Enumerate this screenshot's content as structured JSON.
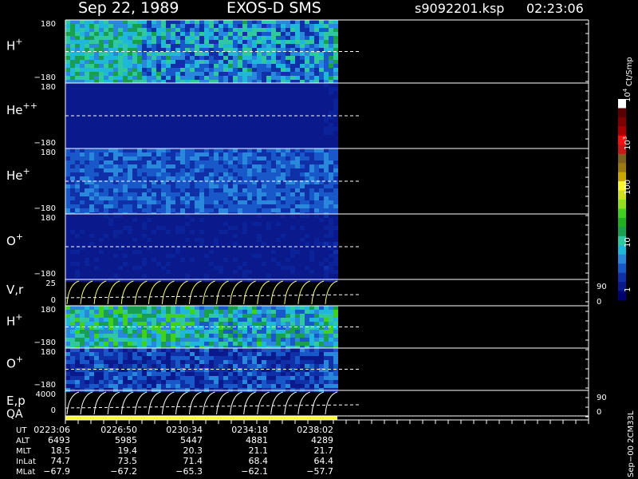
{
  "header": {
    "date": "Sep 22, 1989",
    "instrument": "EXOS-D SMS",
    "file": "s9092201.ksp",
    "time": "02:23:06"
  },
  "chart_data": {
    "type": "heatmap",
    "panels": [
      {
        "id": "h1",
        "label": "H",
        "sup": "+",
        "ymax": "180",
        "ymin": "−180"
      },
      {
        "id": "he2",
        "label": "He",
        "sup": "++",
        "ymax": "180",
        "ymin": "−180"
      },
      {
        "id": "he1",
        "label": "He",
        "sup": "+",
        "ymax": "180",
        "ymin": "−180"
      },
      {
        "id": "o1",
        "label": "O",
        "sup": "+",
        "ymax": "180",
        "ymin": "−180"
      },
      {
        "id": "vr",
        "label": "V,r",
        "sup": "",
        "ymax": "25",
        "ymin": "0",
        "right_top": "90",
        "right_bottom": "0"
      },
      {
        "id": "h2",
        "label": "H",
        "sup": "+",
        "ymax": "180",
        "ymin": "−180"
      },
      {
        "id": "o2",
        "label": "O",
        "sup": "+",
        "ymax": "180",
        "ymin": "−180"
      },
      {
        "id": "ep",
        "label": "E,p",
        "sup": "",
        "ymax": "4000",
        "ymin": "0",
        "right_top": "90",
        "right_bottom": "0"
      },
      {
        "id": "qa",
        "label": "QA",
        "sup": ""
      }
    ],
    "colorbar": {
      "label": "Ct/Smp",
      "ticks": [
        "1",
        "10",
        "100",
        "10",
        "10"
      ],
      "tick_sups": [
        "",
        "",
        "",
        "3",
        "4"
      ],
      "colors": [
        "#000070",
        "#0a1a8c",
        "#1030a8",
        "#1858c8",
        "#2a88dc",
        "#20b8d8",
        "#30c8a0",
        "#18a050",
        "#20b020",
        "#40d020",
        "#90e020",
        "#d0e020",
        "#f8f830",
        "#c8a800",
        "#9a7a10",
        "#806020",
        "#c81818",
        "#ff1010",
        "#a80000",
        "#800000",
        "#5a0000",
        "#ffffff"
      ]
    },
    "time_axis": {
      "rows": [
        {
          "name": "UT",
          "values": [
            "0223:06",
            "0226:50",
            "0230:34",
            "0234:18",
            "0238:02"
          ]
        },
        {
          "name": "ALT",
          "values": [
            "6493",
            "5985",
            "5447",
            "4881",
            "4289"
          ]
        },
        {
          "name": "MLT",
          "values": [
            "18.5",
            "19.4",
            "20.3",
            "21.1",
            "21.7"
          ]
        },
        {
          "name": "InLat",
          "values": [
            "74.7",
            "73.5",
            "71.4",
            "68.4",
            "64.4"
          ]
        },
        {
          "name": "MLat",
          "values": [
            "−67.9",
            "−67.2",
            "−65.3",
            "−62.1",
            "−57.7"
          ]
        }
      ]
    },
    "footer_note": "Sep−00 2CM33L"
  }
}
